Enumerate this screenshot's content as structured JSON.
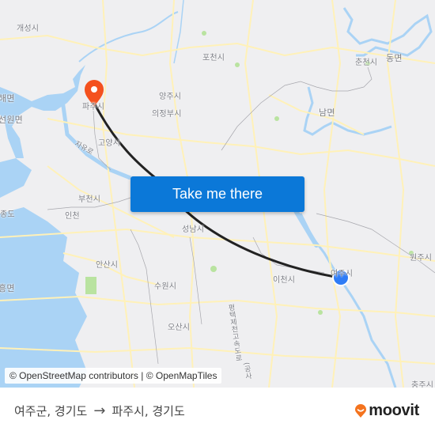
{
  "map": {
    "places": [
      {
        "name": "kaesong",
        "label": "개성시"
      },
      {
        "name": "pocheon",
        "label": "포천시"
      },
      {
        "name": "chuncheon",
        "label": "춘천시"
      },
      {
        "name": "dong-myeon",
        "label": "동면"
      },
      {
        "name": "haemyeon",
        "label": "해면"
      },
      {
        "name": "paju",
        "label": "파주시"
      },
      {
        "name": "yangju",
        "label": "양주시"
      },
      {
        "name": "uijeongbu",
        "label": "의정부시"
      },
      {
        "name": "seonwon-myeon",
        "label": "선원면"
      },
      {
        "name": "nam-myeon",
        "label": "남면"
      },
      {
        "name": "goyang",
        "label": "고양시"
      },
      {
        "name": "jayuro",
        "label": "자유로"
      },
      {
        "name": "bucheon",
        "label": "부천시"
      },
      {
        "name": "jung-do",
        "label": "종도"
      },
      {
        "name": "incheon",
        "label": "인천"
      },
      {
        "name": "seongnam",
        "label": "성남시"
      },
      {
        "name": "wonju",
        "label": "원주시"
      },
      {
        "name": "ansan",
        "label": "안산시"
      },
      {
        "name": "icheon",
        "label": "이천시"
      },
      {
        "name": "yeoju",
        "label": "여주시"
      },
      {
        "name": "hongmyeon",
        "label": "흥면"
      },
      {
        "name": "suwon",
        "label": "수원시"
      },
      {
        "name": "expressway",
        "label": "평택제천고속도로"
      },
      {
        "name": "osan",
        "label": "오산시"
      },
      {
        "name": "chungju",
        "label": "충주시"
      },
      {
        "name": "expressway-sub",
        "label": "(공사"
      }
    ],
    "origin_label": "여주군, 경기도",
    "destination_label": "파주시, 경기도",
    "colors": {
      "origin_marker": "#2f7cf6",
      "destination_marker": "#f4511e",
      "route_line": "#222222",
      "water": "#aad3f5",
      "road": "#fff1b8",
      "park": "#b9e3a0"
    }
  },
  "cta": {
    "label": "Take me there"
  },
  "attribution": {
    "text": "© OpenStreetMap contributors | © OpenMapTiles"
  },
  "footer": {
    "from": "여주군, 경기도",
    "arrow": "→",
    "to": "파주시, 경기도",
    "brand": "moovit"
  }
}
